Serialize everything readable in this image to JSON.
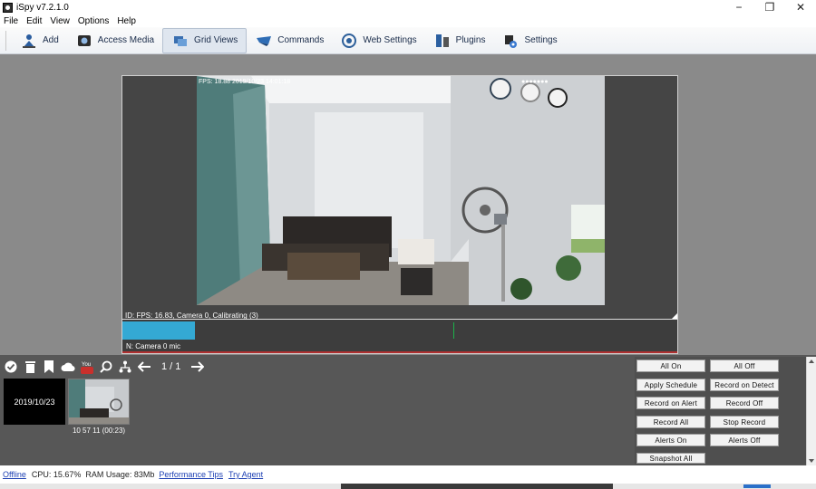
{
  "window": {
    "title": "iSpy v7.2.1.0",
    "controls": [
      "−",
      "❐",
      "✕"
    ]
  },
  "menu": [
    "File",
    "Edit",
    "View",
    "Options",
    "Help"
  ],
  "toolbar": {
    "add": "Add",
    "access_media": "Access Media",
    "grid_views": "Grid Views",
    "commands": "Commands",
    "web_settings": "Web Settings",
    "plugins": "Plugins",
    "settings": "Settings"
  },
  "camera": {
    "timestamp": "FPS: 18.88 2019/10/23 14:01:18",
    "info": "ID: FPS: 16.83, Camera 0, Calibrating (3)",
    "mic_label": "N: Camera 0 mic",
    "progress": 0.13
  },
  "bottom": {
    "pager": "1 / 1",
    "thumb_date": "2019/10/23",
    "thumb_caption": "10 57 11 (00:23)"
  },
  "actions": {
    "all_on": "All On",
    "all_off": "All Off",
    "apply_schedule": "Apply Schedule",
    "record_on_detect": "Record on Detect",
    "record_on_alert": "Record on Alert",
    "record_off": "Record Off",
    "record_all": "Record All",
    "stop_record": "Stop Record",
    "alerts_on": "Alerts On",
    "alerts_off": "Alerts Off",
    "snapshot_all": "Snapshot All"
  },
  "status": {
    "offline": "Offline",
    "cpu": "CPU: 15.67%",
    "ram": "RAM Usage: 83Mb",
    "performance_tips": "Performance Tips",
    "try_agent": "Try Agent"
  }
}
